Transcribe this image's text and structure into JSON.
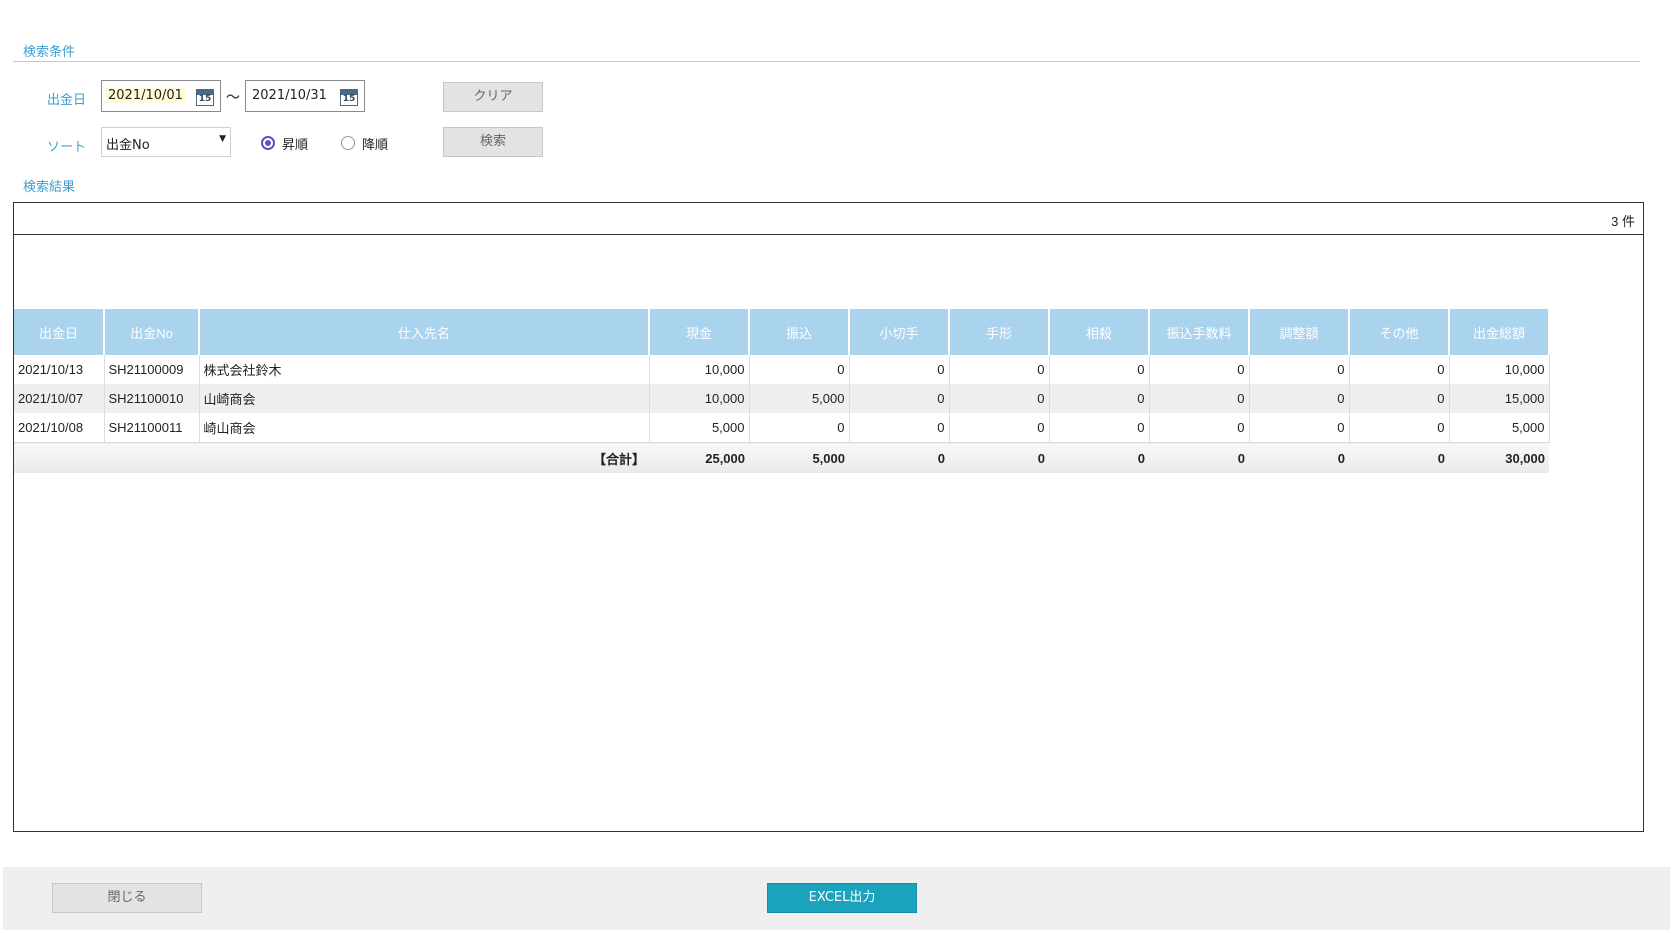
{
  "search": {
    "section_title": "検索条件",
    "date_label": "出金日",
    "date_from": "2021/10/01",
    "date_to": "2021/10/31",
    "tilde": "〜",
    "calendar_icon_text": "15",
    "sort_label": "ソート",
    "sort_value": "出金No",
    "order_asc": "昇順",
    "order_desc": "降順",
    "order_selected": "asc",
    "clear_button": "クリア",
    "search_button": "検索"
  },
  "results": {
    "section_title": "検索結果",
    "count_text": "3 件",
    "columns": [
      "出金日",
      "出金No",
      "仕入先名",
      "現金",
      "振込",
      "小切手",
      "手形",
      "相殺",
      "振込手数料",
      "調整額",
      "その他",
      "出金総額"
    ],
    "rows": [
      [
        "2021/10/13",
        "SH21100009",
        "株式会社鈴木",
        "10,000",
        "0",
        "0",
        "0",
        "0",
        "0",
        "0",
        "0",
        "10,000"
      ],
      [
        "2021/10/07",
        "SH21100010",
        "山崎商会",
        "10,000",
        "5,000",
        "0",
        "0",
        "0",
        "0",
        "0",
        "0",
        "15,000"
      ],
      [
        "2021/10/08",
        "SH21100011",
        "崎山商会",
        "5,000",
        "0",
        "0",
        "0",
        "0",
        "0",
        "0",
        "0",
        "5,000"
      ]
    ],
    "total_label": "【合計】",
    "totals": [
      "25,000",
      "5,000",
      "0",
      "0",
      "0",
      "0",
      "0",
      "0",
      "30,000"
    ]
  },
  "footer": {
    "close_button": "閉じる",
    "excel_button": "EXCEL出力"
  },
  "colors": {
    "accent": "#3c9fd1",
    "header_bg": "#aad3ee",
    "excel_button": "#1ba3bd",
    "radio": "#6a4bc4"
  }
}
